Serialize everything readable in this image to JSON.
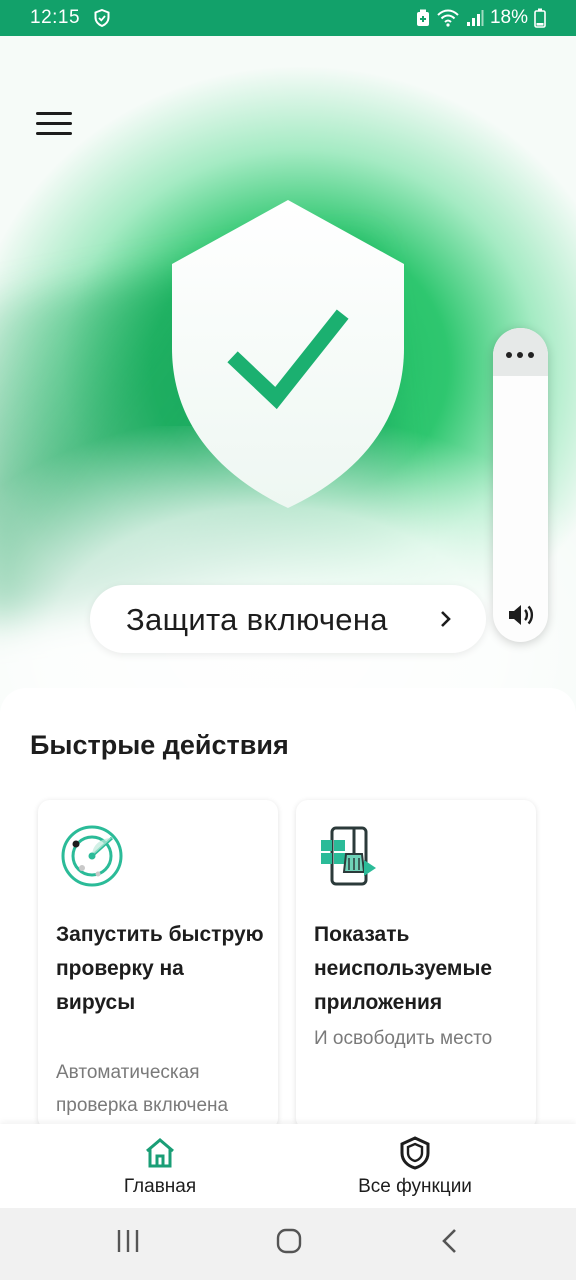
{
  "status_bar": {
    "time": "12:15",
    "battery": "18%"
  },
  "hero": {
    "status_label": "Защита включена"
  },
  "quick_actions": {
    "title": "Быстрые действия",
    "cards": [
      {
        "title": "Запустить быструю проверку на вирусы",
        "subtitle": "Автоматическая проверка включена",
        "icon": "radar-icon"
      },
      {
        "title": "Показать неиспользуемые приложения",
        "subtitle": "И освободить место",
        "icon": "clean-apps-icon"
      }
    ]
  },
  "bottom_nav": {
    "home_label": "Главная",
    "all_label": "Все функции"
  },
  "colors": {
    "accent": "#12a16a",
    "hero_green": "#24c468"
  }
}
